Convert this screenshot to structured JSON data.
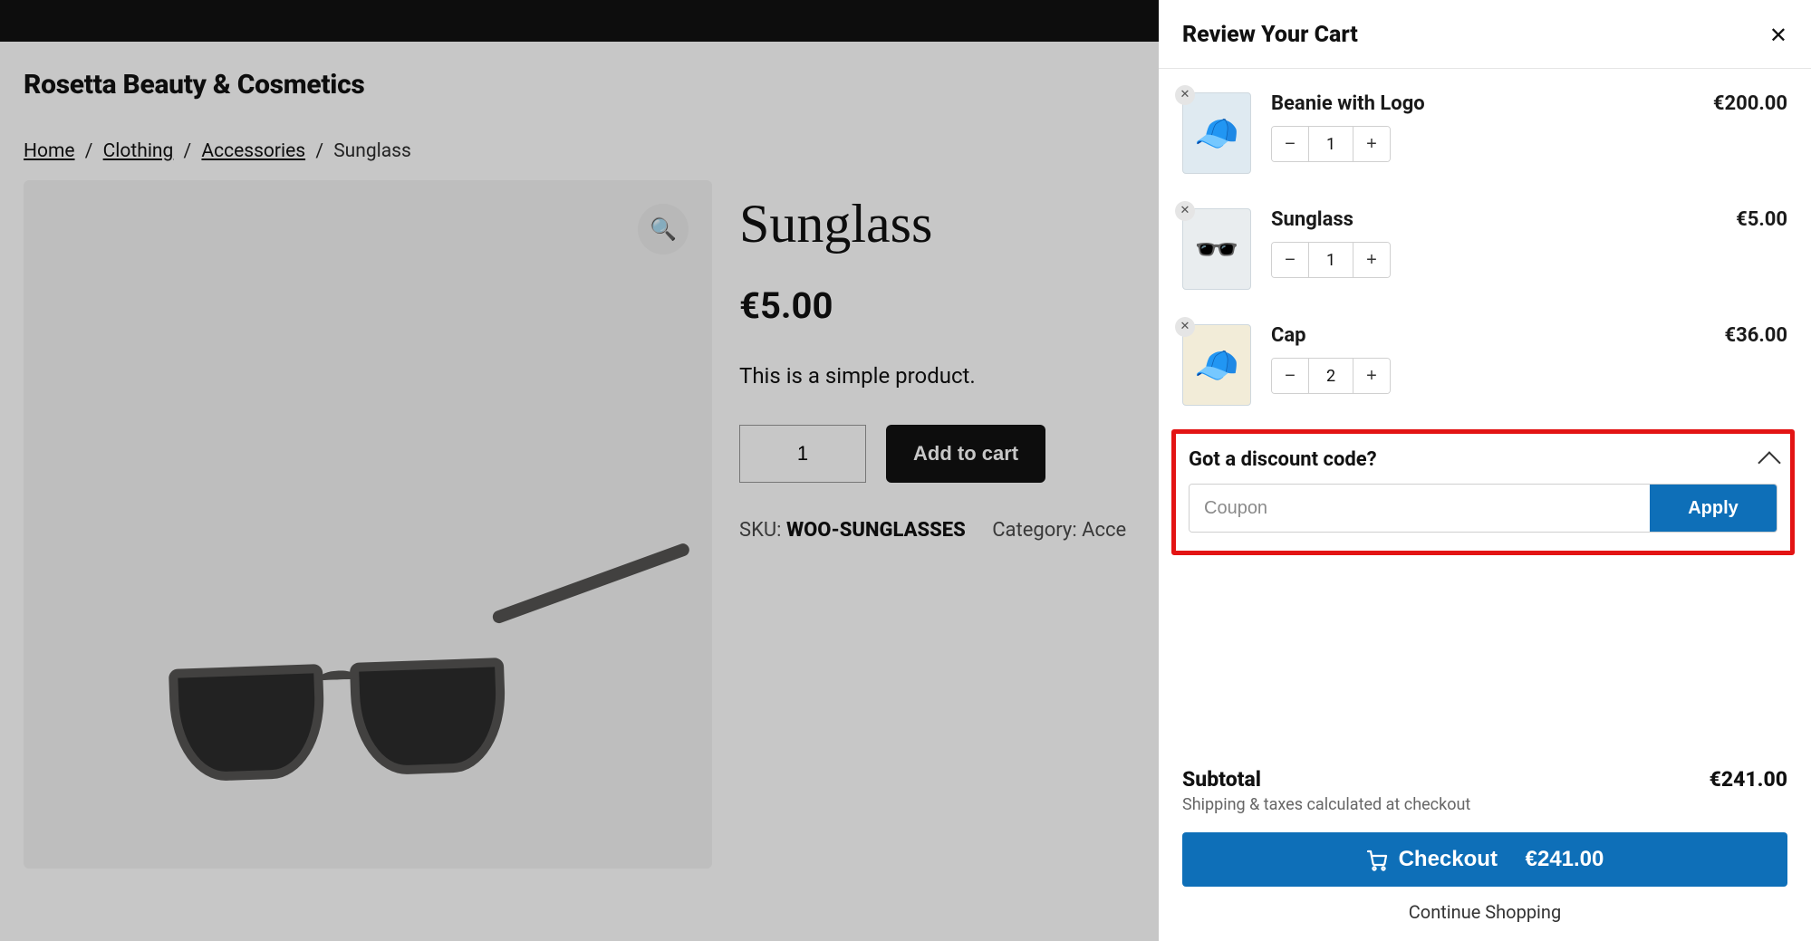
{
  "header": {
    "brand": "Rosetta Beauty & Cosmetics",
    "nav_home": "Home"
  },
  "breadcrumbs": {
    "home": "Home",
    "clothing": "Clothing",
    "accessories": "Accessories",
    "current": "Sunglass"
  },
  "product": {
    "title": "Sunglass",
    "price": "€5.00",
    "description": "This is a simple product.",
    "qty": "1",
    "add_label": "Add to cart",
    "sku_label": "SKU:",
    "sku": "WOO-SUNGLASSES",
    "cat_label": "Category:",
    "cat": "Acce"
  },
  "cart": {
    "title": "Review Your Cart",
    "items": [
      {
        "name": "Beanie with Logo",
        "qty": "1",
        "price": "€200.00",
        "emoji": "🧢"
      },
      {
        "name": "Sunglass",
        "qty": "1",
        "price": "€5.00",
        "emoji": "🕶️"
      },
      {
        "name": "Cap",
        "qty": "2",
        "price": "€36.00",
        "emoji": "🧢"
      }
    ],
    "discount_title": "Got a discount code?",
    "coupon_placeholder": "Coupon",
    "apply_label": "Apply",
    "subtotal_label": "Subtotal",
    "subtotal_value": "€241.00",
    "ship_note": "Shipping & taxes calculated at checkout",
    "checkout_label": "Checkout",
    "checkout_total": "€241.00",
    "continue_label": "Continue Shopping"
  }
}
